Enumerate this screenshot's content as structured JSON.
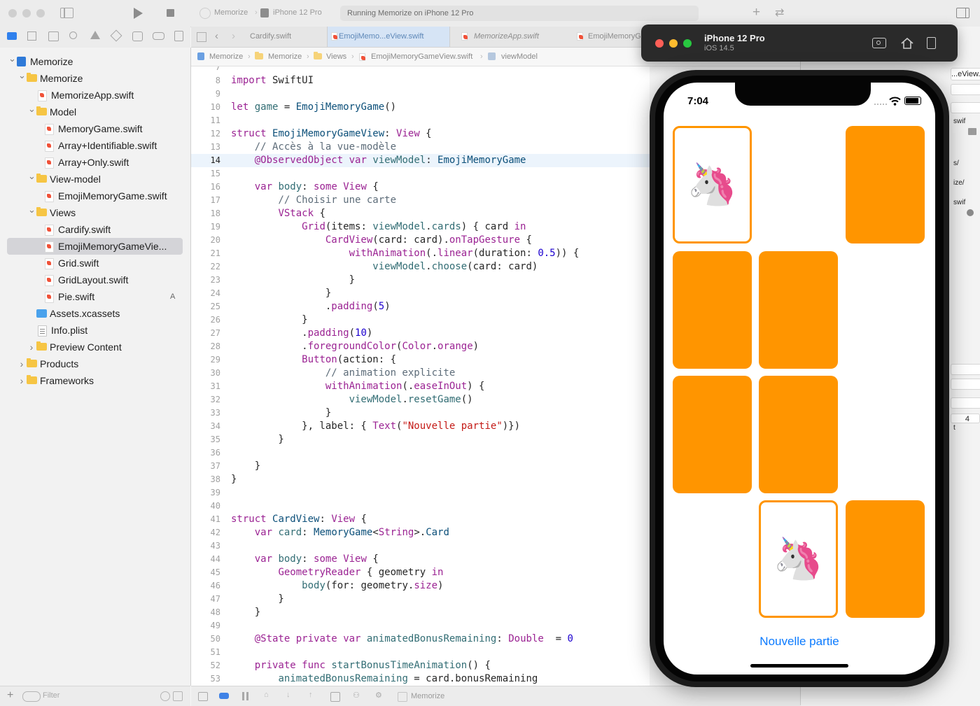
{
  "toolbar": {
    "scheme": "Memorize",
    "destination": "iPhone 12 Pro",
    "activity": "Running Memorize on iPhone 12 Pro",
    "icons": [
      "sidebar-icon",
      "play-icon",
      "stop-icon",
      "plus-icon",
      "swap-icon",
      "inspector-icon"
    ]
  },
  "navigator": {
    "items": [
      {
        "label": "Memorize",
        "kind": "project",
        "depth": 0,
        "expanded": true
      },
      {
        "label": "Memorize",
        "kind": "folder",
        "depth": 1,
        "expanded": true
      },
      {
        "label": "MemorizeApp.swift",
        "kind": "swift",
        "depth": 2
      },
      {
        "label": "Model",
        "kind": "folder",
        "depth": 2,
        "expanded": true
      },
      {
        "label": "MemoryGame.swift",
        "kind": "swift",
        "depth": 3
      },
      {
        "label": "Array+Identifiable.swift",
        "kind": "swift",
        "depth": 3
      },
      {
        "label": "Array+Only.swift",
        "kind": "swift",
        "depth": 3
      },
      {
        "label": "View-model",
        "kind": "folder",
        "depth": 2,
        "expanded": true
      },
      {
        "label": "EmojiMemoryGame.swift",
        "kind": "swift",
        "depth": 3
      },
      {
        "label": "Views",
        "kind": "folder",
        "depth": 2,
        "expanded": true
      },
      {
        "label": "Cardify.swift",
        "kind": "swift",
        "depth": 3
      },
      {
        "label": "EmojiMemoryGameVie...",
        "kind": "swift",
        "depth": 3,
        "selected": true
      },
      {
        "label": "Grid.swift",
        "kind": "swift",
        "depth": 3
      },
      {
        "label": "GridLayout.swift",
        "kind": "swift",
        "depth": 3
      },
      {
        "label": "Pie.swift",
        "kind": "swift",
        "depth": 3,
        "badge": "A"
      },
      {
        "label": "Assets.xcassets",
        "kind": "assets",
        "depth": 2
      },
      {
        "label": "Info.plist",
        "kind": "plist",
        "depth": 2
      },
      {
        "label": "Preview Content",
        "kind": "folder",
        "depth": 2,
        "expanded": false
      },
      {
        "label": "Products",
        "kind": "folder",
        "depth": 1,
        "expanded": false
      },
      {
        "label": "Frameworks",
        "kind": "folder",
        "depth": 1,
        "expanded": false
      }
    ],
    "filter_placeholder": "Filter"
  },
  "tabs": [
    {
      "label": "Cardify.swift"
    },
    {
      "label": "EmojiMemo...eView.swift",
      "active": true
    },
    {
      "label": "MemorizeApp.swift"
    },
    {
      "label": "EmojiMemoryG"
    }
  ],
  "jumpbar": [
    "Memorize",
    "Memorize",
    "Views",
    "EmojiMemoryGameView.swift",
    "viewModel"
  ],
  "editor": {
    "current_line": 14,
    "lines": [
      {
        "n": "7",
        "parts": [
          [
            "",
            ""
          ]
        ]
      },
      {
        "n": "8",
        "parts": [
          [
            "kw",
            "import"
          ],
          [
            "",
            " SwiftUI"
          ]
        ]
      },
      {
        "n": "9",
        "parts": [
          [
            "",
            ""
          ]
        ]
      },
      {
        "n": "10",
        "parts": [
          [
            "kw",
            "let"
          ],
          [
            "",
            " "
          ],
          [
            "fn",
            "game"
          ],
          [
            "",
            " = "
          ],
          [
            "ty",
            "EmojiMemoryGame"
          ],
          [
            "",
            "()"
          ]
        ]
      },
      {
        "n": "11",
        "parts": [
          [
            "",
            ""
          ]
        ]
      },
      {
        "n": "12",
        "parts": [
          [
            "kw",
            "struct"
          ],
          [
            "",
            " "
          ],
          [
            "ty",
            "EmojiMemoryGameView"
          ],
          [
            "",
            ": "
          ],
          [
            "kw",
            "View"
          ],
          [
            "",
            " {"
          ]
        ]
      },
      {
        "n": "13",
        "parts": [
          [
            "cm",
            "    // Accès à la vue-modèle"
          ]
        ]
      },
      {
        "n": "14",
        "parts": [
          [
            "",
            "    "
          ],
          [
            "kw",
            "@ObservedObject"
          ],
          [
            "",
            " "
          ],
          [
            "kw",
            "var"
          ],
          [
            "",
            " "
          ],
          [
            "fn",
            "viewModel"
          ],
          [
            "",
            ": "
          ],
          [
            "ty",
            "EmojiMemoryGame"
          ]
        ]
      },
      {
        "n": "15",
        "parts": [
          [
            "",
            ""
          ]
        ]
      },
      {
        "n": "16",
        "parts": [
          [
            "",
            "    "
          ],
          [
            "kw",
            "var"
          ],
          [
            "",
            " "
          ],
          [
            "fn",
            "body"
          ],
          [
            "",
            ": "
          ],
          [
            "kw",
            "some"
          ],
          [
            "",
            " "
          ],
          [
            "kw",
            "View"
          ],
          [
            "",
            " {"
          ]
        ]
      },
      {
        "n": "17",
        "parts": [
          [
            "cm",
            "        // Choisir une carte"
          ]
        ]
      },
      {
        "n": "18",
        "parts": [
          [
            "",
            "        "
          ],
          [
            "kw",
            "VStack"
          ],
          [
            "",
            " {"
          ]
        ]
      },
      {
        "n": "19",
        "parts": [
          [
            "",
            "            "
          ],
          [
            "kw",
            "Grid"
          ],
          [
            "",
            "(items: "
          ],
          [
            "fn",
            "viewModel"
          ],
          [
            "",
            "."
          ],
          [
            "fn",
            "cards"
          ],
          [
            "",
            ") { card "
          ],
          [
            "kw",
            "in"
          ]
        ]
      },
      {
        "n": "20",
        "parts": [
          [
            "",
            "                "
          ],
          [
            "kw",
            "CardView"
          ],
          [
            "",
            "(card: card)."
          ],
          [
            "kw",
            "onTapGesture"
          ],
          [
            "",
            " {"
          ]
        ]
      },
      {
        "n": "21",
        "parts": [
          [
            "",
            "                    "
          ],
          [
            "kw",
            "withAnimation"
          ],
          [
            "",
            "(."
          ],
          [
            "kw",
            "linear"
          ],
          [
            "",
            "(duration: "
          ],
          [
            "nm",
            "0.5"
          ],
          [
            "",
            ")) {"
          ]
        ]
      },
      {
        "n": "22",
        "parts": [
          [
            "",
            "                        "
          ],
          [
            "fn",
            "viewModel"
          ],
          [
            "",
            "."
          ],
          [
            "fn",
            "choose"
          ],
          [
            "",
            "(card: card)"
          ]
        ]
      },
      {
        "n": "23",
        "parts": [
          [
            "",
            "                    }"
          ]
        ]
      },
      {
        "n": "24",
        "parts": [
          [
            "",
            "                }"
          ]
        ]
      },
      {
        "n": "25",
        "parts": [
          [
            "",
            "                ."
          ],
          [
            "kw",
            "padding"
          ],
          [
            "",
            "("
          ],
          [
            "nm",
            "5"
          ],
          [
            "",
            ")"
          ]
        ]
      },
      {
        "n": "26",
        "parts": [
          [
            "",
            "            }"
          ]
        ]
      },
      {
        "n": "27",
        "parts": [
          [
            "",
            "            ."
          ],
          [
            "kw",
            "padding"
          ],
          [
            "",
            "("
          ],
          [
            "nm",
            "10"
          ],
          [
            "",
            ")"
          ]
        ]
      },
      {
        "n": "28",
        "parts": [
          [
            "",
            "            ."
          ],
          [
            "kw",
            "foregroundColor"
          ],
          [
            "",
            "("
          ],
          [
            "kw",
            "Color"
          ],
          [
            "",
            "."
          ],
          [
            "kw",
            "orange"
          ],
          [
            "",
            ")"
          ]
        ]
      },
      {
        "n": "29",
        "parts": [
          [
            "",
            "            "
          ],
          [
            "kw",
            "Button"
          ],
          [
            "",
            "(action: {"
          ]
        ]
      },
      {
        "n": "30",
        "parts": [
          [
            "cm",
            "                // animation explicite"
          ]
        ]
      },
      {
        "n": "31",
        "parts": [
          [
            "",
            "                "
          ],
          [
            "kw",
            "withAnimation"
          ],
          [
            "",
            "(."
          ],
          [
            "kw",
            "easeInOut"
          ],
          [
            "",
            ") {"
          ]
        ]
      },
      {
        "n": "32",
        "parts": [
          [
            "",
            "                    "
          ],
          [
            "fn",
            "viewModel"
          ],
          [
            "",
            "."
          ],
          [
            "fn",
            "resetGame"
          ],
          [
            "",
            "()"
          ]
        ]
      },
      {
        "n": "33",
        "parts": [
          [
            "",
            "                }"
          ]
        ]
      },
      {
        "n": "34",
        "parts": [
          [
            "",
            "            }, label: { "
          ],
          [
            "kw",
            "Text"
          ],
          [
            "",
            "("
          ],
          [
            "st",
            "\"Nouvelle partie\""
          ],
          [
            "",
            ")})"
          ]
        ]
      },
      {
        "n": "35",
        "parts": [
          [
            "",
            "        }"
          ]
        ]
      },
      {
        "n": "36",
        "parts": [
          [
            "",
            ""
          ]
        ]
      },
      {
        "n": "37",
        "parts": [
          [
            "",
            "    }"
          ]
        ]
      },
      {
        "n": "38",
        "parts": [
          [
            "",
            "}"
          ]
        ]
      },
      {
        "n": "39",
        "parts": [
          [
            "",
            ""
          ]
        ]
      },
      {
        "n": "40",
        "parts": [
          [
            "",
            ""
          ]
        ]
      },
      {
        "n": "41",
        "parts": [
          [
            "kw",
            "struct"
          ],
          [
            "",
            " "
          ],
          [
            "ty",
            "CardView"
          ],
          [
            "",
            ": "
          ],
          [
            "kw",
            "View"
          ],
          [
            "",
            " {"
          ]
        ]
      },
      {
        "n": "42",
        "parts": [
          [
            "",
            "    "
          ],
          [
            "kw",
            "var"
          ],
          [
            "",
            " "
          ],
          [
            "fn",
            "card"
          ],
          [
            "",
            ": "
          ],
          [
            "ty",
            "MemoryGame"
          ],
          [
            "",
            "<"
          ],
          [
            "kw",
            "String"
          ],
          [
            "",
            ">."
          ],
          [
            "ty",
            "Card"
          ]
        ]
      },
      {
        "n": "43",
        "parts": [
          [
            "",
            ""
          ]
        ]
      },
      {
        "n": "44",
        "parts": [
          [
            "",
            "    "
          ],
          [
            "kw",
            "var"
          ],
          [
            "",
            " "
          ],
          [
            "fn",
            "body"
          ],
          [
            "",
            ": "
          ],
          [
            "kw",
            "some"
          ],
          [
            "",
            " "
          ],
          [
            "kw",
            "View"
          ],
          [
            "",
            " {"
          ]
        ]
      },
      {
        "n": "45",
        "parts": [
          [
            "",
            "        "
          ],
          [
            "kw",
            "GeometryReader"
          ],
          [
            "",
            " { geometry "
          ],
          [
            "kw",
            "in"
          ]
        ]
      },
      {
        "n": "46",
        "parts": [
          [
            "",
            "            "
          ],
          [
            "fn",
            "body"
          ],
          [
            "",
            "(for: geometry."
          ],
          [
            "kw",
            "size"
          ],
          [
            "",
            ")"
          ]
        ]
      },
      {
        "n": "47",
        "parts": [
          [
            "",
            "        }"
          ]
        ]
      },
      {
        "n": "48",
        "parts": [
          [
            "",
            "    }"
          ]
        ]
      },
      {
        "n": "49",
        "parts": [
          [
            "",
            ""
          ]
        ]
      },
      {
        "n": "50",
        "parts": [
          [
            "",
            "    "
          ],
          [
            "kw",
            "@State"
          ],
          [
            "",
            " "
          ],
          [
            "kw",
            "private"
          ],
          [
            "",
            " "
          ],
          [
            "kw",
            "var"
          ],
          [
            "",
            " "
          ],
          [
            "fn",
            "animatedBonusRemaining"
          ],
          [
            "",
            ": "
          ],
          [
            "kw",
            "Double"
          ],
          [
            "",
            "  = "
          ],
          [
            "nm",
            "0"
          ]
        ]
      },
      {
        "n": "51",
        "parts": [
          [
            "",
            ""
          ]
        ]
      },
      {
        "n": "52",
        "parts": [
          [
            "",
            "    "
          ],
          [
            "kw",
            "private"
          ],
          [
            "",
            " "
          ],
          [
            "kw",
            "func"
          ],
          [
            "",
            " "
          ],
          [
            "fn",
            "startBonusTimeAnimation"
          ],
          [
            "",
            "() {"
          ]
        ]
      },
      {
        "n": "53",
        "parts": [
          [
            "",
            "        "
          ],
          [
            "fn",
            "animatedBonusRemaining"
          ],
          [
            "",
            " = card.bonusRemaining"
          ]
        ]
      }
    ]
  },
  "status": {
    "target": "Memorize"
  },
  "inspector": {
    "filename": "...eView.swift",
    "fragments": [
      "swif",
      "s/",
      "ize/",
      "swif",
      "t",
      "4"
    ]
  },
  "simulator": {
    "device": "iPhone 12 Pro",
    "os": "iOS 14.5",
    "icons": [
      "screenshot-icon",
      "home-icon",
      "rotate-icon"
    ],
    "time": "7:04",
    "button_label": "Nouvelle partie",
    "card_color": "#ff9500",
    "cards": [
      {
        "row": 0,
        "col": 0,
        "state": "face-up",
        "emoji": "🦄"
      },
      {
        "row": 0,
        "col": 1,
        "state": "matched"
      },
      {
        "row": 0,
        "col": 2,
        "state": "face-down"
      },
      {
        "row": 1,
        "col": 0,
        "state": "face-down"
      },
      {
        "row": 1,
        "col": 1,
        "state": "face-down"
      },
      {
        "row": 1,
        "col": 2,
        "state": "matched"
      },
      {
        "row": 2,
        "col": 0,
        "state": "face-down"
      },
      {
        "row": 2,
        "col": 1,
        "state": "face-down"
      },
      {
        "row": 2,
        "col": 2,
        "state": "matched"
      },
      {
        "row": 3,
        "col": 0,
        "state": "matched"
      },
      {
        "row": 3,
        "col": 1,
        "state": "face-up",
        "emoji": "🦄"
      },
      {
        "row": 3,
        "col": 2,
        "state": "face-down"
      }
    ]
  }
}
